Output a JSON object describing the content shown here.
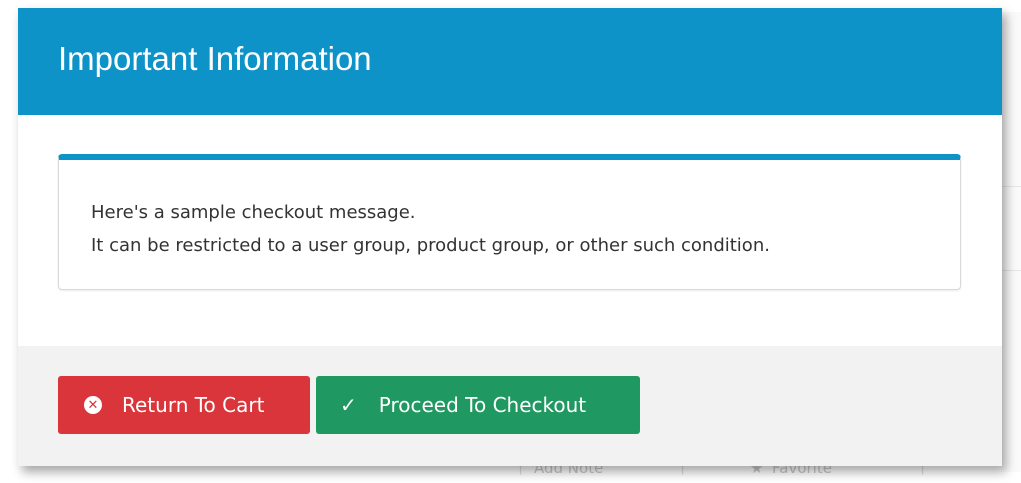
{
  "modal": {
    "title": "Important Information",
    "message": {
      "line1": "Here's a sample checkout message.",
      "line2": "It can be restricted to a user group, product group, or other such condition."
    },
    "buttons": {
      "return_label": "Return To Cart",
      "return_icon": "circle-x-icon",
      "proceed_label": "Proceed To Checkout",
      "proceed_icon": "checkmark-icon"
    }
  },
  "background": {
    "footer_items": [
      "Add Note",
      "Favorite"
    ]
  },
  "colors": {
    "header": "#0e93c9",
    "return_button": "#d9353a",
    "proceed_button": "#1f9961",
    "footer_bg": "#f2f2f2"
  }
}
